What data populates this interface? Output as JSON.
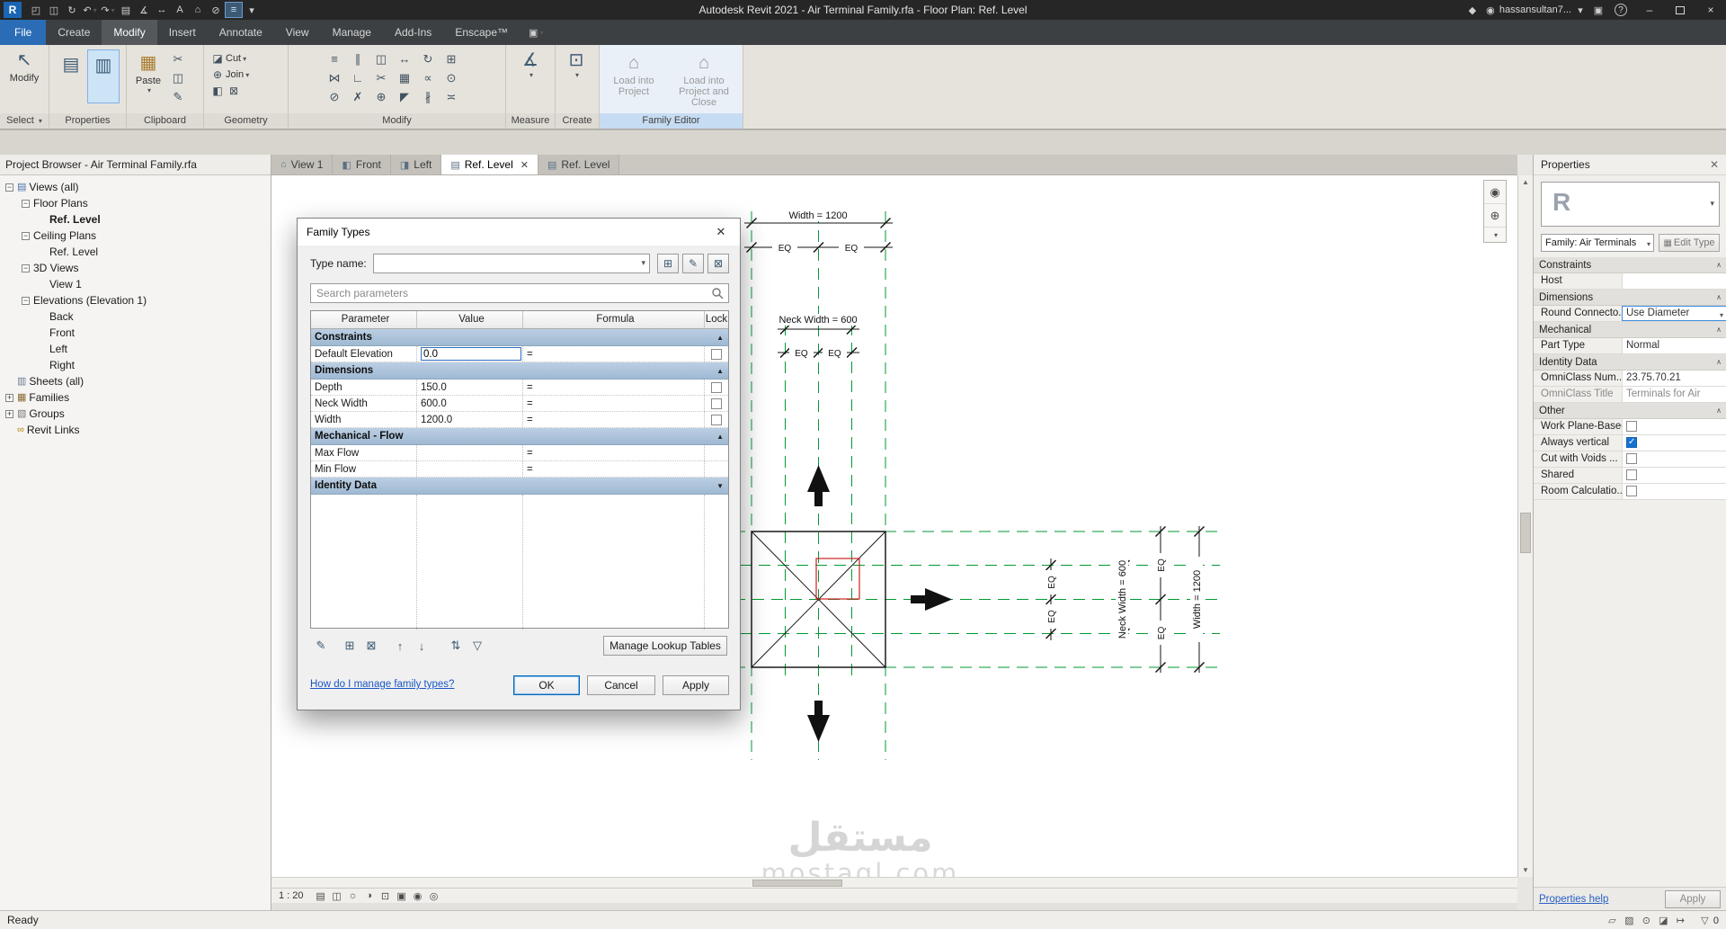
{
  "titlebar": {
    "title": "Autodesk Revit 2021 - Air Terminal Family.rfa - Floor Plan: Ref. Level",
    "username": "hassansultan7..."
  },
  "tabs": {
    "items": [
      "File",
      "Create",
      "Modify",
      "Insert",
      "Annotate",
      "View",
      "Manage",
      "Add-Ins",
      "Enscape™"
    ]
  },
  "ribbon": {
    "select_button": "Modify",
    "select_label": "Select",
    "properties_label": "Properties",
    "paste": "Paste",
    "clipboard_label": "Clipboard",
    "cut": "Cut",
    "join": "Join",
    "geometry_label": "Geometry",
    "modify_label": "Modify",
    "measure_label": "Measure",
    "create_label": "Create",
    "load_project": "Load into Project",
    "load_project_close": "Load into Project and Close",
    "family_editor_label": "Family Editor"
  },
  "browser": {
    "header": "Project Browser - Air Terminal Family.rfa",
    "items": [
      {
        "label": "Views (all)"
      },
      {
        "label": "Floor Plans"
      },
      {
        "label": "Ref. Level"
      },
      {
        "label": "Ceiling Plans"
      },
      {
        "label": "Ref. Level"
      },
      {
        "label": "3D Views"
      },
      {
        "label": "View 1"
      },
      {
        "label": "Elevations (Elevation 1)"
      },
      {
        "label": "Back"
      },
      {
        "label": "Front"
      },
      {
        "label": "Left"
      },
      {
        "label": "Right"
      },
      {
        "label": "Sheets (all)"
      },
      {
        "label": "Families"
      },
      {
        "label": "Groups"
      },
      {
        "label": "Revit Links"
      }
    ]
  },
  "viewtabs": {
    "items": [
      "View 1",
      "Front",
      "Left",
      "Ref. Level",
      "Ref. Level"
    ]
  },
  "dialog": {
    "title": "Family Types",
    "type_name_label": "Type name:",
    "search_placeholder": "Search parameters",
    "columns": [
      "Parameter",
      "Value",
      "Formula",
      "Lock"
    ],
    "rows": [
      {
        "label": "Constraints"
      },
      {
        "param": "Default Elevation",
        "value": "0.0",
        "formula": "="
      },
      {
        "label": "Dimensions"
      },
      {
        "param": "Depth",
        "value": "150.0",
        "formula": "="
      },
      {
        "param": "Neck Width",
        "value": "600.0",
        "formula": "="
      },
      {
        "param": "Width",
        "value": "1200.0",
        "formula": "="
      },
      {
        "label": "Mechanical - Flow"
      },
      {
        "param": "Max Flow",
        "value": "",
        "formula": "="
      },
      {
        "param": "Min Flow",
        "value": "",
        "formula": "="
      },
      {
        "label": "Identity Data"
      }
    ],
    "manage_lookup": "Manage Lookup Tables",
    "help_link": "How do I manage family types?",
    "ok": "OK",
    "cancel": "Cancel",
    "apply": "Apply"
  },
  "drawing": {
    "width_label": "Width = 1200",
    "neck_label": "Neck Width = 600",
    "eq": "EQ"
  },
  "props": {
    "header": "Properties",
    "family": "Family: Air Terminals",
    "edit_type": "Edit Type",
    "rows": [
      {
        "label": "Constraints"
      },
      {
        "label": "Host",
        "value": ""
      },
      {
        "label": "Dimensions"
      },
      {
        "label": "Round Connecto...",
        "value": "Use Diameter"
      },
      {
        "label": "Mechanical"
      },
      {
        "label": "Part Type",
        "value": "Normal"
      },
      {
        "label": "Identity Data"
      },
      {
        "label": "OmniClass Num...",
        "value": "23.75.70.21"
      },
      {
        "label": "OmniClass Title",
        "value": "Terminals for Air"
      },
      {
        "label": "Other"
      },
      {
        "label": "Work Plane-Based",
        "checked": false
      },
      {
        "label": "Always vertical",
        "checked": true
      },
      {
        "label": "Cut with Voids ...",
        "checked": false
      },
      {
        "label": "Shared",
        "checked": false
      },
      {
        "label": "Room Calculatio...",
        "checked": false
      }
    ],
    "help": "Properties help",
    "apply": "Apply"
  },
  "viewbar": {
    "scale": "1 : 20"
  },
  "status": {
    "ready": "Ready",
    "filter_count": "0"
  },
  "watermark": {
    "ar": "مستقل",
    "en": "mostaql.com"
  }
}
